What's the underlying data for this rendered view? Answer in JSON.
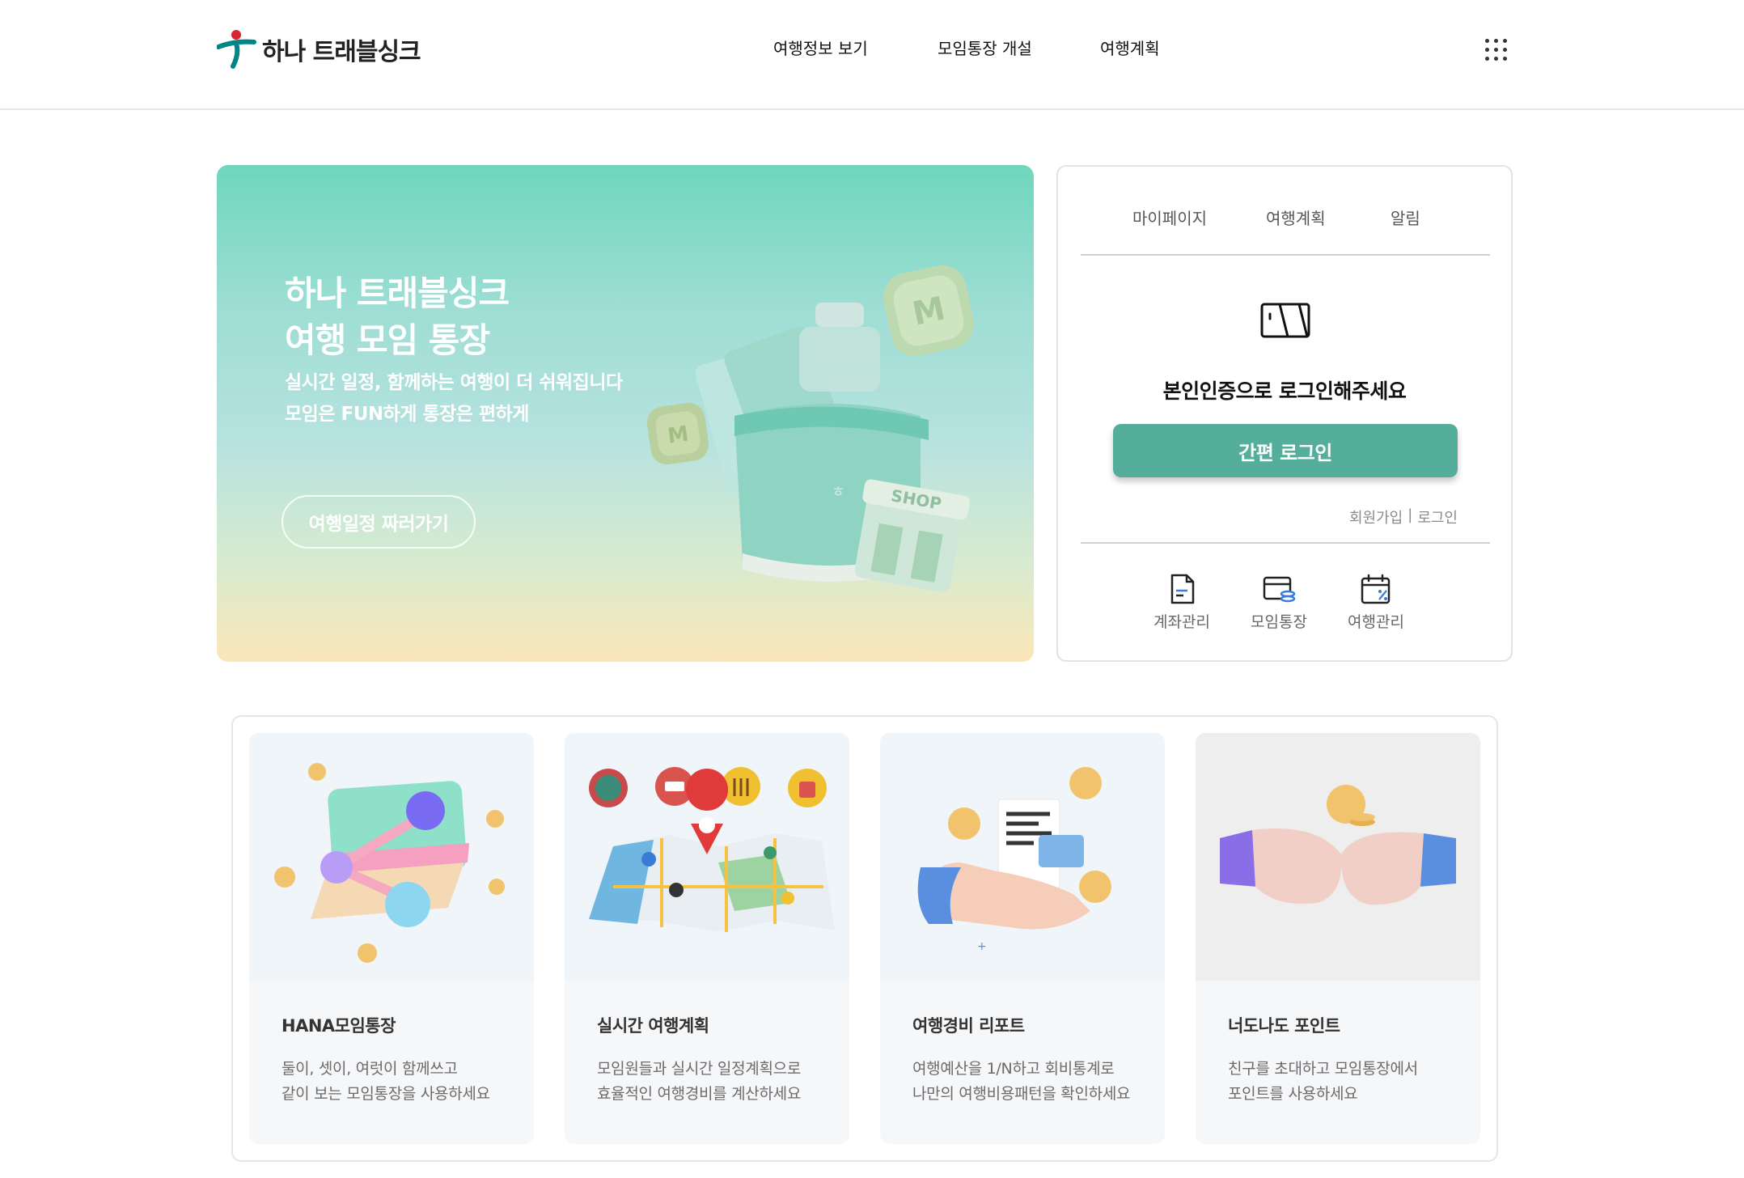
{
  "header": {
    "logo_text": "하나 트래블싱크",
    "nav": [
      "여행정보 보기",
      "모임통장 개설",
      "여행계획"
    ]
  },
  "hero": {
    "title_line1": "하나 트래블싱크",
    "title_line2": "여행 모임 통장",
    "sub_line1": "실시간 일정, 함께하는 여행이 더 쉬워집니다",
    "sub_line2": "모임은 FUN하게 통장은 편하게",
    "button": "여행일정 짜러가기",
    "art_shop_text": "SHOP",
    "art_coin_text": "M"
  },
  "panel": {
    "tabs": [
      "마이페이지",
      "여행계획",
      "알림"
    ],
    "message": "본인인증으로 로그인해주세요",
    "login_button": "간편 로그인",
    "signup": "회원가입",
    "separator": "|",
    "login": "로그인",
    "quick_menu": [
      {
        "label": "계좌관리",
        "icon": "document-icon"
      },
      {
        "label": "모임통장",
        "icon": "card-coins-icon"
      },
      {
        "label": "여행관리",
        "icon": "calendar-percent-icon"
      }
    ]
  },
  "cards": [
    {
      "title": "HANA모임통장",
      "desc_line1": "둘이, 셋이, 여럿이 함께쓰고",
      "desc_line2": "같이 보는 모임통장을 사용하세요"
    },
    {
      "title": "실시간 여행계획",
      "desc_line1": "모임원들과 실시간 일정계획으로",
      "desc_line2": "효율적인 여행경비를 계산하세요"
    },
    {
      "title": "여행경비 리포트",
      "desc_line1": "여행예산을 1/N하고 회비통계로",
      "desc_line2": "나만의 여행비용패턴을 확인하세요"
    },
    {
      "title": "너도나도 포인트",
      "desc_line1": "친구를 초대하고 모임통장에서",
      "desc_line2": "포인트를 사용하세요"
    }
  ],
  "colors": {
    "accent": "#55ad9b",
    "brand_red": "#d9232e",
    "brand_green": "#008485"
  }
}
